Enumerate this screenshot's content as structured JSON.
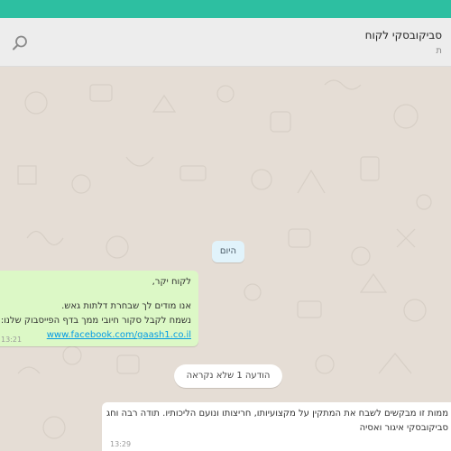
{
  "header": {
    "title": "סביקובסקי לקוח",
    "subtitle": "ת",
    "search_icon": "search-icon"
  },
  "chat": {
    "date_separator": "היום",
    "outgoing_message": {
      "line1": "לקוח יקר,",
      "line2": "אנו מודים לך שבחרת דלתות גאש.",
      "line3": "נשמח לקבל סקור חיובי ממך בדף הפייסבוק שלנו:",
      "link": "www.facebook.com/gaash1.co.il",
      "time": "13:21"
    },
    "unread_notice": "הודעה 1 שלא נקראה",
    "incoming_message": {
      "line1": "ממות זו מבקשים לשבח את המתקין על מקצועיותו, חריצותו ונועם הליכותיו. תודה רבה וחג",
      "line2": "סביקובסקי איגור ואסיה",
      "time": "13:29"
    }
  },
  "colors": {
    "topbar": "#2dbfa1",
    "header_bg": "#ededed",
    "wallpaper": "#e5ddd5",
    "outgoing_bubble": "#dcf8c6",
    "incoming_bubble": "#ffffff",
    "date_chip": "#e1f3fb",
    "link": "#039be5"
  }
}
